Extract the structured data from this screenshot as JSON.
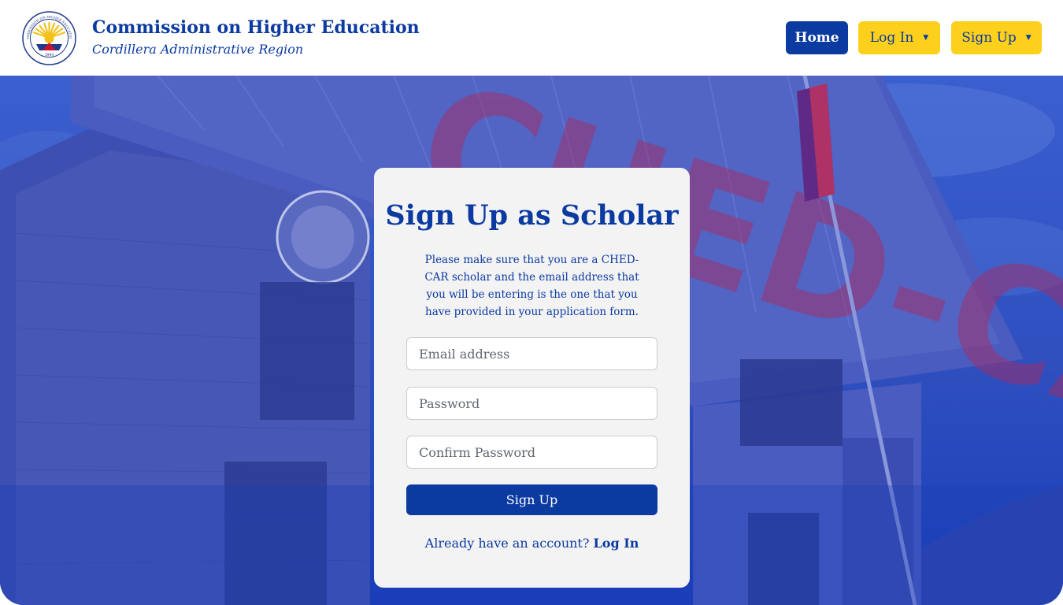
{
  "header": {
    "title": "Commission on Higher Education",
    "subtitle": "Cordillera Administrative Region",
    "seal_text": "COMMISSION ON HIGHER EDUCATION",
    "seal_year": "1994"
  },
  "nav": {
    "home": "Home",
    "login": "Log In",
    "signup": "Sign Up"
  },
  "hero": {
    "sign_text": "CHED-CAR"
  },
  "form": {
    "title": "Sign Up as Scholar",
    "description": "Please make sure that you are a CHED-CAR scholar and the email address that you will be entering is the one that you have provided in your application form.",
    "email_placeholder": "Email address",
    "password_placeholder": "Password",
    "confirm_placeholder": "Confirm Password",
    "submit": "Sign Up",
    "already_text": "Already have an account?",
    "login_link": "Log In"
  },
  "colors": {
    "primary_blue": "#0b3aa0",
    "accent_yellow": "#fdd01b",
    "card_bg": "#f3f3f4"
  },
  "icons": [
    "ched-seal-icon",
    "caret-down-icon",
    "flag-icon"
  ]
}
